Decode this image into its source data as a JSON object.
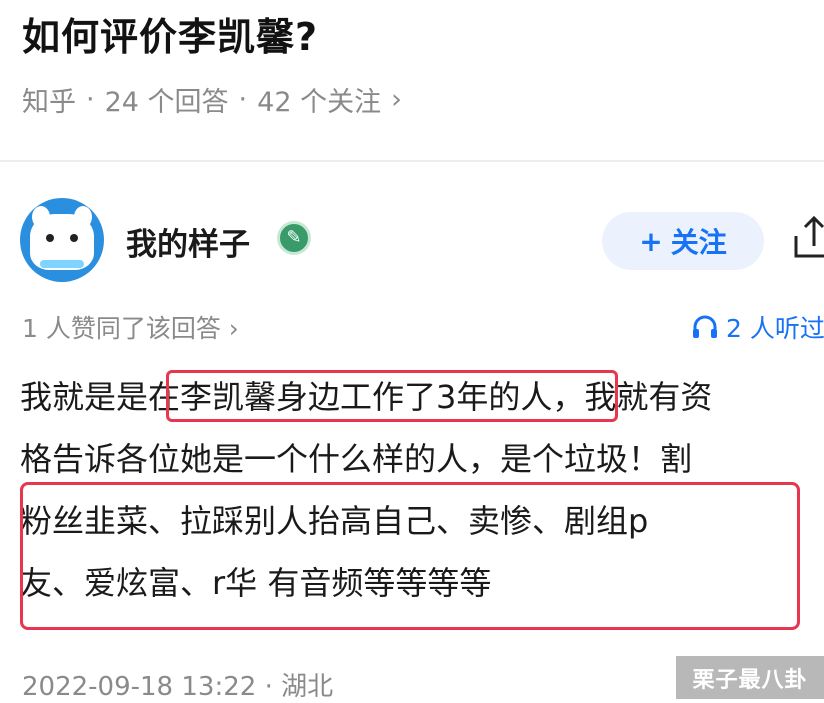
{
  "question": {
    "title": "如何评价李凯馨?",
    "source": "知乎",
    "answers": "24 个回答",
    "followers": "42 个关注",
    "sep": "·",
    "chevron": "›"
  },
  "author": {
    "name": "我的样子",
    "follow_label": "关注",
    "follow_plus": "+",
    "icons": {
      "avatar": "avatar-dog",
      "verify": "verified-badge-icon",
      "share": "share-icon"
    }
  },
  "answer_meta": {
    "agree_text": "1 人赞同了该回答 ›",
    "listen_text": "2 人听过"
  },
  "content_lines": [
    "我就是是在李凯馨身边工作了3年的人，我就有资",
    "格告诉各位她是一个什么样的人，是个垃圾！割",
    "粉丝韭菜、拉踩别人抬高自己、卖惨、剧组p",
    "友、爱炫富、r华 有音频等等等等"
  ],
  "footer": {
    "datetime": "2022-09-18 13:22",
    "location": "湖北",
    "sep": "·"
  },
  "watermark": "栗子最八卦",
  "colors": {
    "accent": "#1772f6",
    "highlight": "#e8364f",
    "muted": "#8a8a8a"
  }
}
